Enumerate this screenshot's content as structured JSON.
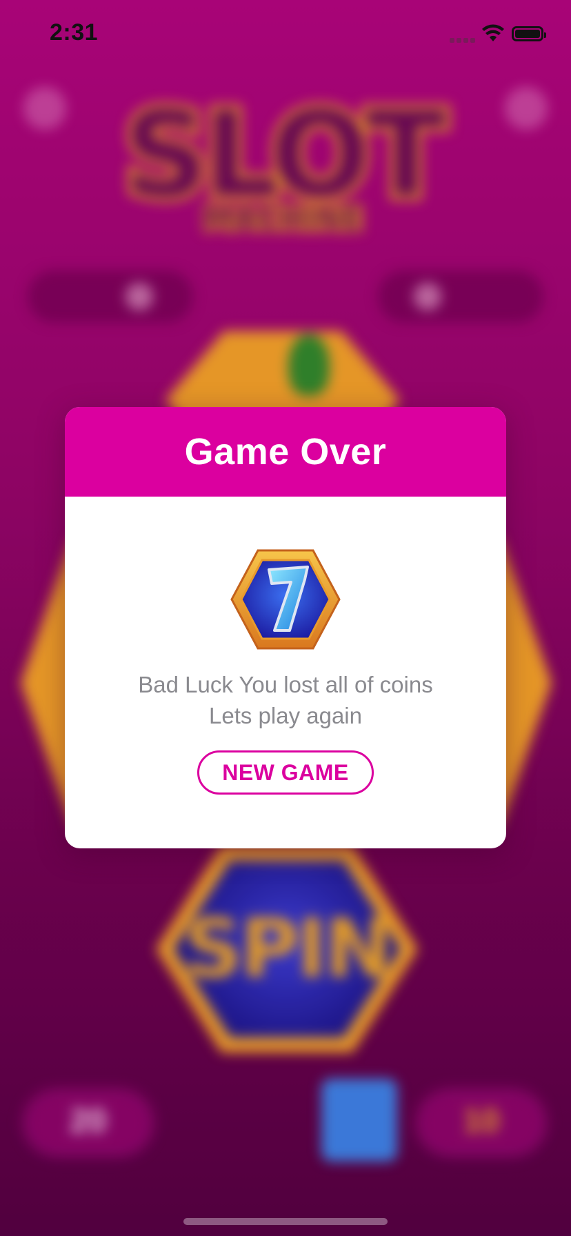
{
  "status_bar": {
    "time": "2:31"
  },
  "background": {
    "logo_title": "SLOT",
    "logo_subtitle": "MACHINE",
    "spin_label": "SPIN",
    "bet_value": "20",
    "coins_value": "10"
  },
  "modal": {
    "title": "Game Over",
    "message_line1": "Bad Luck You lost all of coins",
    "message_line2": "Lets play again",
    "button_label": "NEW GAME",
    "badge_icon": "lucky-seven-icon"
  },
  "colors": {
    "accent": "#db009f",
    "background_top": "#b0057d",
    "background_bottom": "#520040",
    "message_text": "#8a8a8f"
  }
}
